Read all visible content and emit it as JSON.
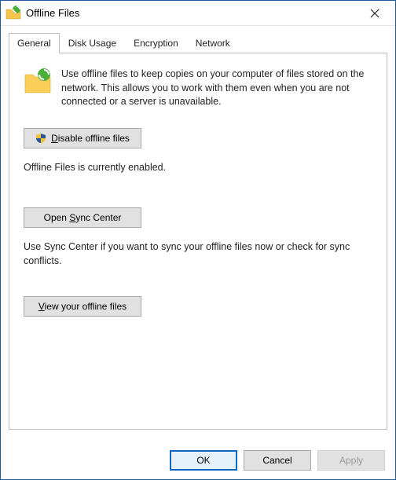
{
  "window": {
    "title": "Offline Files"
  },
  "tabs": {
    "general": "General",
    "disk_usage": "Disk Usage",
    "encryption": "Encryption",
    "network": "Network"
  },
  "general": {
    "intro": "Use offline files to keep copies on your computer of files stored on the network.  This allows you to work with them even when you are not connected or a server is unavailable.",
    "disable_btn_prefix": "",
    "disable_btn_u": "D",
    "disable_btn_rest": "isable offline files",
    "status": "Offline Files is currently enabled.",
    "sync_btn_prefix": "Open ",
    "sync_btn_u": "S",
    "sync_btn_rest": "ync Center",
    "sync_desc": "Use Sync Center if you want to sync your offline files now or check for sync conflicts.",
    "view_btn_u": "V",
    "view_btn_rest": "iew your offline files"
  },
  "buttons": {
    "ok": "OK",
    "cancel": "Cancel",
    "apply": "Apply"
  }
}
